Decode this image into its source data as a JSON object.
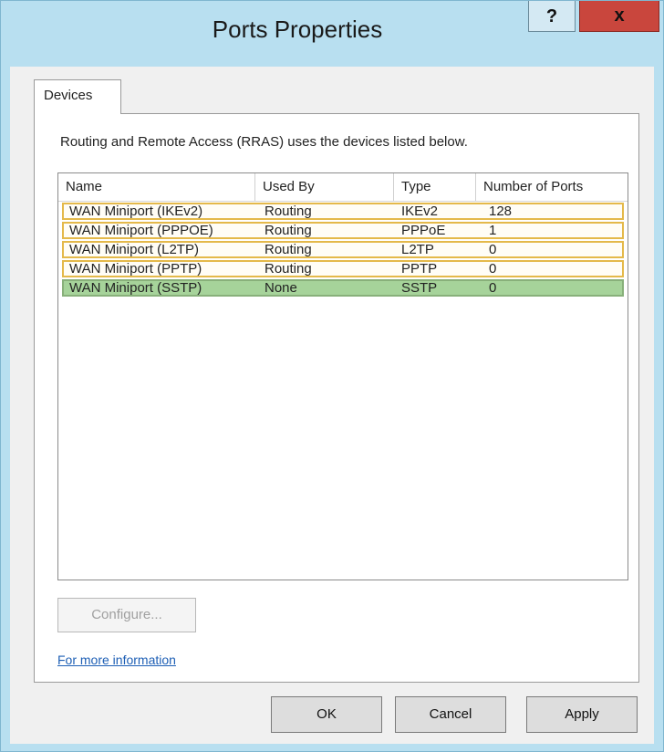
{
  "window": {
    "title": "Ports Properties",
    "help_label": "?",
    "close_label": "x"
  },
  "tabs": [
    {
      "label": "Devices",
      "selected": true
    }
  ],
  "description": "Routing and Remote Access (RRAS) uses the devices listed below.",
  "table": {
    "columns": [
      "Name",
      "Used By",
      "Type",
      "Number of Ports"
    ],
    "rows": [
      {
        "name": "WAN Miniport (IKEv2)",
        "used_by": "Routing",
        "type": "IKEv2",
        "ports": "128"
      },
      {
        "name": "WAN Miniport (PPPOE)",
        "used_by": "Routing",
        "type": "PPPoE",
        "ports": "1"
      },
      {
        "name": "WAN Miniport (L2TP)",
        "used_by": "Routing",
        "type": "L2TP",
        "ports": "0"
      },
      {
        "name": "WAN Miniport (PPTP)",
        "used_by": "Routing",
        "type": "PPTP",
        "ports": "0"
      },
      {
        "name": "WAN Miniport (SSTP)",
        "used_by": "None",
        "type": "SSTP",
        "ports": "0",
        "selected": true
      }
    ]
  },
  "configure_label": "Configure...",
  "more_info_label": "For more information",
  "buttons": {
    "ok": "OK",
    "cancel": "Cancel",
    "apply": "Apply"
  },
  "colors": {
    "titlebar": "#b8dff0",
    "close_button": "#c9463d",
    "row_outline": "#e4b94a",
    "selected_row": "#a6d39a",
    "link": "#1e5fb5"
  }
}
